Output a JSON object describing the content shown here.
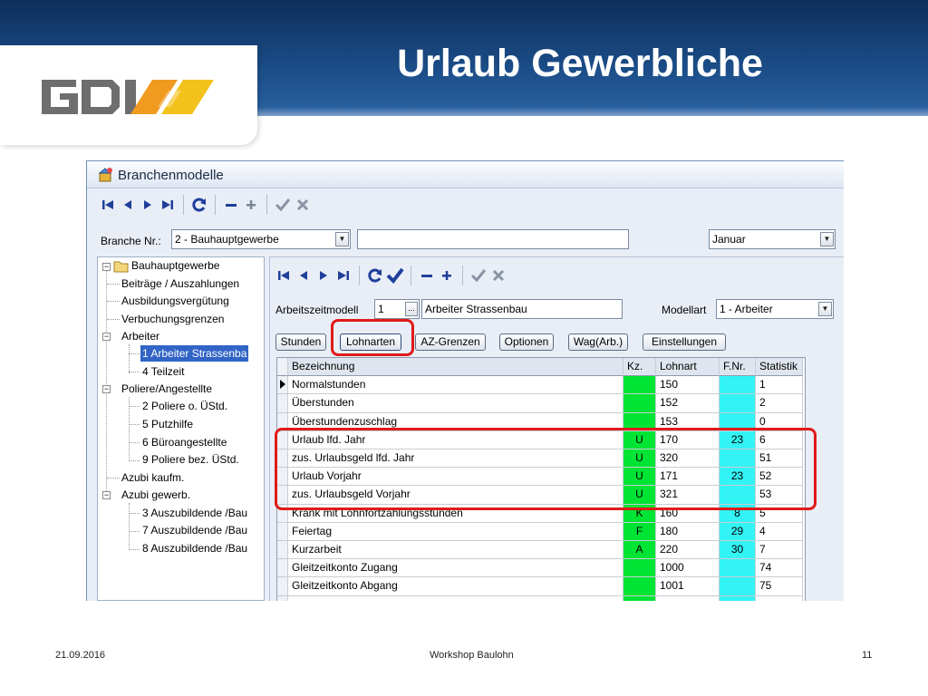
{
  "slide": {
    "title": "Urlaub Gewerbliche",
    "logo_text": "GDI",
    "footer": {
      "date": "21.09.2016",
      "center": "Workshop Baulohn",
      "page": "11"
    }
  },
  "window": {
    "title": "Branchenmodelle",
    "toolbar_icons": [
      "first-icon",
      "prev-icon",
      "next-icon",
      "last-icon",
      "refresh-icon",
      "minus-icon",
      "plus-icon",
      "check-icon",
      "cancel-icon"
    ],
    "branche_label": "Branche Nr.:",
    "branche_value": "2 - Bauhauptgewerbe",
    "month_value": "Januar"
  },
  "tree": {
    "root": "Bauhauptgewerbe",
    "items": [
      "Beiträge / Auszahlungen",
      "Ausbildungsvergütung",
      "Verbuchungsgrenzen",
      "Arbeiter",
      "1 Arbeiter Strassenba",
      "4 Teilzeit",
      "Poliere/Angestellte",
      "2 Poliere o. ÜStd.",
      "5 Putzhilfe",
      "6 Büroangestellte",
      "9 Poliere bez. ÜStd.",
      "Azubi kaufm.",
      "Azubi gewerb.",
      "3 Auszubildende /Bau",
      "7 Auszubildende /Bau",
      "8 Auszubildende /Bau"
    ]
  },
  "sub": {
    "az_label": "Arbeitszeitmodell",
    "az_num": "1",
    "az_btn": "...",
    "az_name": "Arbeiter Strassenbau",
    "modell_label": "Modellart",
    "modell_value": "1 - Arbeiter",
    "buttons": [
      "Stunden",
      "Lohnarten",
      "AZ-Grenzen",
      "Optionen",
      "Wag(Arb.)",
      "Einstellungen"
    ]
  },
  "grid": {
    "headers": [
      "Bezeichnung",
      "Kz.",
      "Lohnart",
      "F.Nr.",
      "Statistik"
    ],
    "rows": [
      [
        "Normalstunden",
        "",
        "150",
        "",
        "1"
      ],
      [
        "Überstunden",
        "",
        "152",
        "",
        "2"
      ],
      [
        "Überstundenzuschlag",
        "",
        "153",
        "",
        "0"
      ],
      [
        "Urlaub lfd. Jahr",
        "U",
        "170",
        "23",
        "6"
      ],
      [
        "zus. Urlaubsgeld lfd. Jahr",
        "U",
        "320",
        "",
        "51"
      ],
      [
        "Urlaub Vorjahr",
        "U",
        "171",
        "23",
        "52"
      ],
      [
        "zus. Urlaubsgeld Vorjahr",
        "U",
        "321",
        "",
        "53"
      ],
      [
        "Krank mit Lohnfortzahlungsstunden",
        "K",
        "160",
        "8",
        "5"
      ],
      [
        "Feiertag",
        "F",
        "180",
        "29",
        "4"
      ],
      [
        "Kurzarbeit",
        "A",
        "220",
        "30",
        "7"
      ],
      [
        "Gleitzeitkonto Zugang",
        "",
        "1000",
        "",
        "74"
      ],
      [
        "Gleitzeitkonto Abgang",
        "",
        "1001",
        "",
        "75"
      ],
      [
        "",
        "",
        "",
        "",
        ""
      ]
    ]
  },
  "colors": {
    "header_blue": "#1a4b85",
    "highlight_red": "#e01a1a",
    "kz_green": "#00e533",
    "fnr_cyan": "#33f3f5",
    "selection": "#3164c6"
  }
}
